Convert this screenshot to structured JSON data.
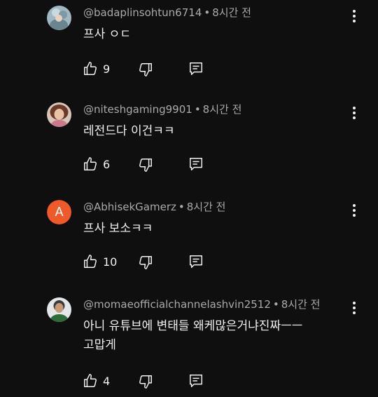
{
  "comments": [
    {
      "author": "@badaplinsohtun6714",
      "time": "8시간 전",
      "separator": "•",
      "lines": [
        "프사 ㅇㄷ"
      ],
      "likes": "9"
    },
    {
      "author": "@niteshgaming9901",
      "time": "8시간 전",
      "separator": "•",
      "lines": [
        "레전드다 이건ㅋㅋ"
      ],
      "likes": "6"
    },
    {
      "author": "@AbhisekGamerz",
      "time": "8시간 전",
      "separator": "•",
      "avatar_letter": "A",
      "avatar_color": "#ef5a2b",
      "lines": [
        "프사 보소ㅋㅋ"
      ],
      "likes": "10"
    },
    {
      "author": "@momaeofficialchannelashvin2512",
      "time": "8시간 전",
      "separator": "•",
      "lines": [
        "아니 유튜브에 변태들 왜케많은거냐진짜ㅡㅡ",
        "고맙게"
      ],
      "likes": "4"
    }
  ],
  "icons": {
    "like": "thumb-up-icon",
    "dislike": "thumb-down-icon",
    "reply": "comment-icon",
    "more": "more-vertical-icon"
  },
  "colors": {
    "background": "#0f0f0f",
    "text": "#f1f1f1",
    "meta": "#aaaaaa"
  }
}
